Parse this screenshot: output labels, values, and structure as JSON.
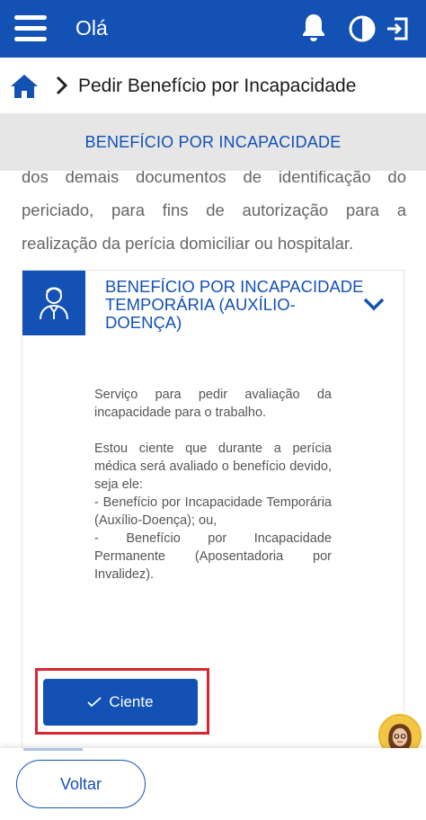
{
  "header": {
    "greeting": "Olá",
    "icons": [
      "menu-icon",
      "bell-icon",
      "contrast-icon",
      "logout-icon"
    ],
    "background": "#1351b4"
  },
  "breadcrumb": {
    "label": "Pedir Benefício por Incapacidade",
    "icons": [
      "home-icon",
      "chevron-right-icon"
    ]
  },
  "section": {
    "title": "BENEFÍCIO POR INCAPACIDADE"
  },
  "intro": {
    "text": "dos demais documentos de identificação do periciado, para fins de autorização para a realização da perícia domiciliar ou hospitalar."
  },
  "card": {
    "title": "BENEFÍCIO POR INCAPACIDADE TEMPORÁRIA (AUXÍLIO-DOENÇA)",
    "icon": "doctor-icon",
    "paragraph1": "Serviço para pedir avaliação da incapacidade para o trabalho.",
    "paragraph2": "Estou ciente que durante a perícia médica será avaliado o benefício devido, seja ele:\n- Benefício por Incapacidade Temporária (Auxílio-Doença); ou,\n- Benefício por Incapacidade Permanente (Aposentadoria por Invalidez).",
    "button_label": "Ciente"
  },
  "footer": {
    "back_label": "Voltar"
  },
  "colors": {
    "primary": "#1351b4",
    "highlight": "#d9262e",
    "section_bg": "#e6e6e6"
  }
}
